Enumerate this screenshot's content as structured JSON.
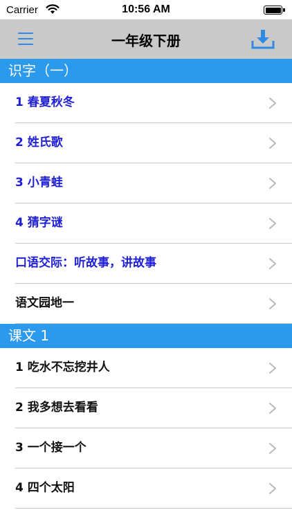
{
  "status_bar": {
    "carrier": "Carrier",
    "time": "10:56 AM"
  },
  "nav": {
    "title": "一年级下册",
    "menu_icon": "hamburger-menu-icon",
    "download_icon": "download-icon"
  },
  "colors": {
    "accent": "#2d8be6",
    "section_header_bg": "#2b99ec",
    "nav_bg": "#c9c9c9",
    "blue_text": "#1f1fd6",
    "dark_text": "#111111"
  },
  "sections": [
    {
      "header": "识字（一）",
      "items": [
        {
          "label": "1 春夏秋冬",
          "style": "blue"
        },
        {
          "label": "2 姓氏歌",
          "style": "blue"
        },
        {
          "label": "3 小青蛙",
          "style": "blue"
        },
        {
          "label": "4 猜字谜",
          "style": "blue"
        },
        {
          "label": "口语交际：听故事，讲故事",
          "style": "blue"
        },
        {
          "label": "语文园地一",
          "style": "dark"
        }
      ]
    },
    {
      "header": "课文 1",
      "items": [
        {
          "label": "1 吃水不忘挖井人",
          "style": "dark"
        },
        {
          "label": "2 我多想去看看",
          "style": "dark"
        },
        {
          "label": "3 一个接一个",
          "style": "dark"
        },
        {
          "label": "4 四个太阳",
          "style": "dark"
        }
      ]
    }
  ]
}
